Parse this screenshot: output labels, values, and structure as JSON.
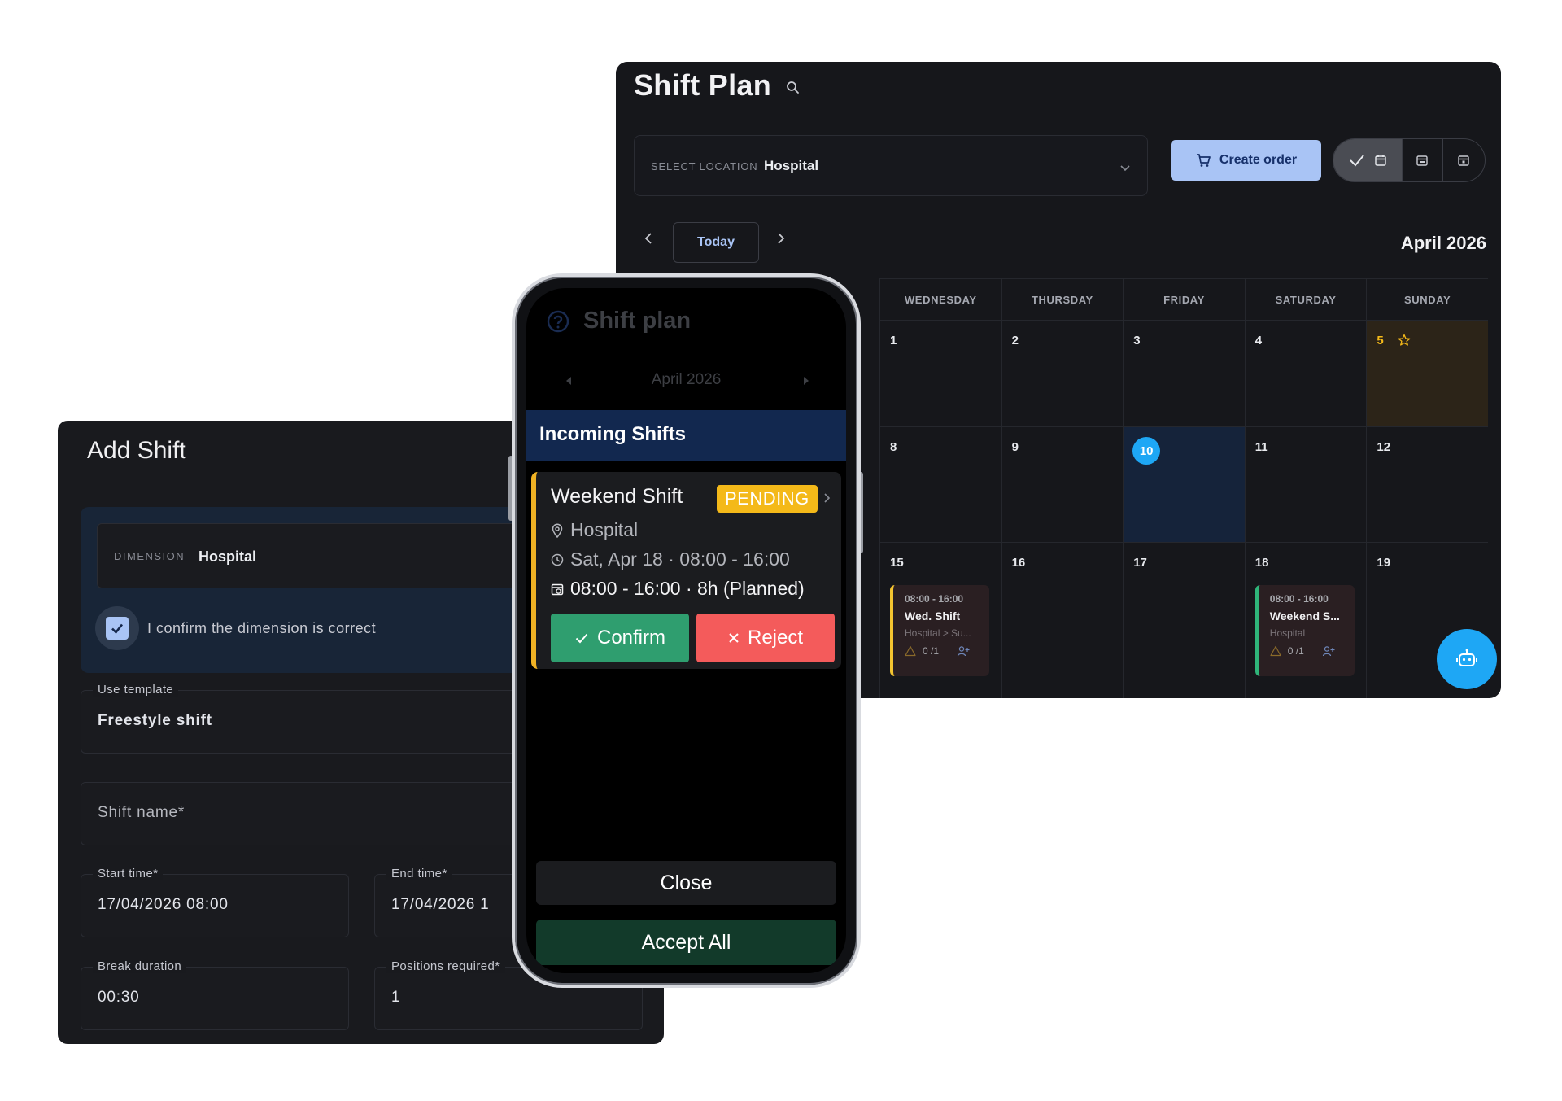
{
  "shift_plan": {
    "title": "Shift Plan",
    "location_label": "SELECT LOCATION",
    "location_value": "Hospital",
    "create_order_label": "Create order",
    "today_label": "Today",
    "month_label": "April 2026",
    "weekdays": [
      "WEDNESDAY",
      "THURSDAY",
      "FRIDAY",
      "SATURDAY",
      "SUNDAY"
    ],
    "weeks": [
      [
        "1",
        "2",
        "3",
        "4",
        "5"
      ],
      [
        "8",
        "9",
        "10",
        "11",
        "12"
      ],
      [
        "15",
        "16",
        "17",
        "18",
        "19"
      ]
    ],
    "shift_cards": [
      {
        "time": "08:00 - 16:00",
        "name": "Wed. Shift",
        "location": "Hospital > Su...",
        "count": "0 /1"
      },
      {
        "time": "08:00 - 16:00",
        "name": "Weekend S...",
        "location": "Hospital",
        "count": "0 /1"
      }
    ],
    "colors": {
      "accent": "#a9c4f5",
      "today": "#1ea7f5",
      "weekend_star": "#f4b919"
    }
  },
  "add_shift": {
    "title": "Add Shift",
    "dimension_label": "DIMENSION",
    "dimension_value": "Hospital",
    "confirm_label": "I confirm the dimension is correct",
    "template_label": "Use template",
    "template_value": "Freestyle shift",
    "shift_name_placeholder": "Shift name*",
    "start_label": "Start time*",
    "start_value": "17/04/2026 08:00",
    "end_label": "End time*",
    "end_value": "17/04/2026 1",
    "break_label": "Break duration",
    "break_value": "00:30",
    "positions_label": "Positions required*",
    "positions_value": "1"
  },
  "phone": {
    "title": "Shift plan",
    "month": "April 2026",
    "sheet_title": "Incoming Shifts",
    "card": {
      "name": "Weekend Shift",
      "status": "PENDING",
      "location": "Hospital",
      "date": "Sat, Apr 18 · 08:00 - 16:00",
      "planned": "08:00 - 16:00 · 8h (Planned)"
    },
    "confirm_label": "Confirm",
    "reject_label": "Reject",
    "close_label": "Close",
    "accept_all_label": "Accept All",
    "colors": {
      "pending": "#f4b919",
      "confirm": "#2f9e6f",
      "reject": "#f45b5b"
    }
  }
}
